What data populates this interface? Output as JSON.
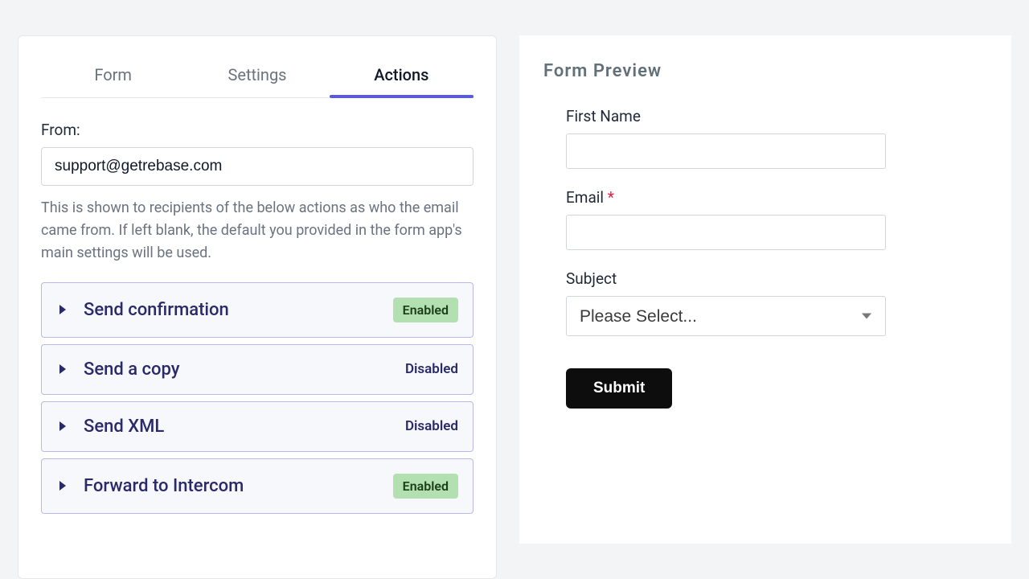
{
  "tabs": {
    "form": "Form",
    "settings": "Settings",
    "actions": "Actions"
  },
  "from": {
    "label": "From:",
    "value": "support@getrebase.com",
    "helper": "This is shown to recipients of the below actions as who the email came from. If left blank, the default you provided in the form app's main settings will be used."
  },
  "status": {
    "enabled": "Enabled",
    "disabled": "Disabled"
  },
  "actions": [
    {
      "title": "Send confirmation",
      "enabled": true
    },
    {
      "title": "Send a copy",
      "enabled": false
    },
    {
      "title": "Send XML",
      "enabled": false
    },
    {
      "title": "Forward to Intercom",
      "enabled": true
    }
  ],
  "preview": {
    "heading": "Form Preview",
    "first_name_label": "First Name",
    "email_label": "Email ",
    "subject_label": "Subject",
    "subject_placeholder": "Please Select...",
    "submit_label": "Submit"
  }
}
